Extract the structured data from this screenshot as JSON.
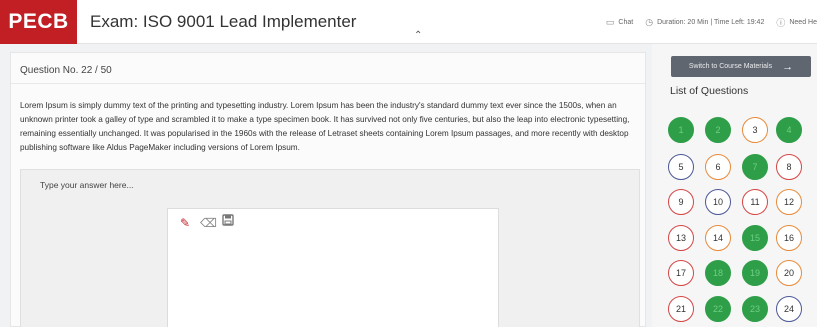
{
  "header": {
    "brand": "PECB",
    "title": "Exam: ISO 9001 Lead Implementer",
    "chat_label": "Chat",
    "duration_text": "Duration: 20 Min | Time Left: 19:42",
    "help_label": "Need He"
  },
  "question": {
    "number_label": "Question No. 22 / 50",
    "text": "Lorem Ipsum is simply dummy text of the printing and typesetting industry. Lorem Ipsum has been the industry's standard dummy text ever since the 1500s, when an unknown printer took a galley of type and scrambled it to make a type specimen book. It has survived not only five centuries, but also the leap into electronic typesetting, remaining essentially unchanged. It was popularised in the 1960s with the release of Letraset sheets containing Lorem Ipsum passages, and more recently with desktop publishing software like Aldus PageMaker including versions of Lorem Ipsum."
  },
  "answer": {
    "placeholder": "Type your answer here..."
  },
  "sidebar": {
    "switch_label": "Switch to Course Materials",
    "list_title": "List of Questions",
    "questions": [
      {
        "n": "1",
        "status": "answered"
      },
      {
        "n": "2",
        "status": "answered"
      },
      {
        "n": "3",
        "status": "visited"
      },
      {
        "n": "4",
        "status": "answered"
      },
      {
        "n": "5",
        "status": "current"
      },
      {
        "n": "6",
        "status": "visited"
      },
      {
        "n": "7",
        "status": "answered"
      },
      {
        "n": "8",
        "status": "unvisited"
      },
      {
        "n": "9",
        "status": "unvisited"
      },
      {
        "n": "10",
        "status": "current"
      },
      {
        "n": "11",
        "status": "unvisited"
      },
      {
        "n": "12",
        "status": "visited"
      },
      {
        "n": "13",
        "status": "unvisited"
      },
      {
        "n": "14",
        "status": "visited"
      },
      {
        "n": "15",
        "status": "answered"
      },
      {
        "n": "16",
        "status": "visited"
      },
      {
        "n": "17",
        "status": "unvisited"
      },
      {
        "n": "18",
        "status": "answered"
      },
      {
        "n": "19",
        "status": "answered"
      },
      {
        "n": "20",
        "status": "visited"
      },
      {
        "n": "21",
        "status": "unvisited"
      },
      {
        "n": "22",
        "status": "answered"
      },
      {
        "n": "23",
        "status": "answered"
      },
      {
        "n": "24",
        "status": "current"
      }
    ]
  },
  "colors": {
    "brand": "#c21f25",
    "answered": "#2e9e48",
    "unvisited": "#d54545",
    "visited": "#e78a3c",
    "current": "#4a5896"
  }
}
